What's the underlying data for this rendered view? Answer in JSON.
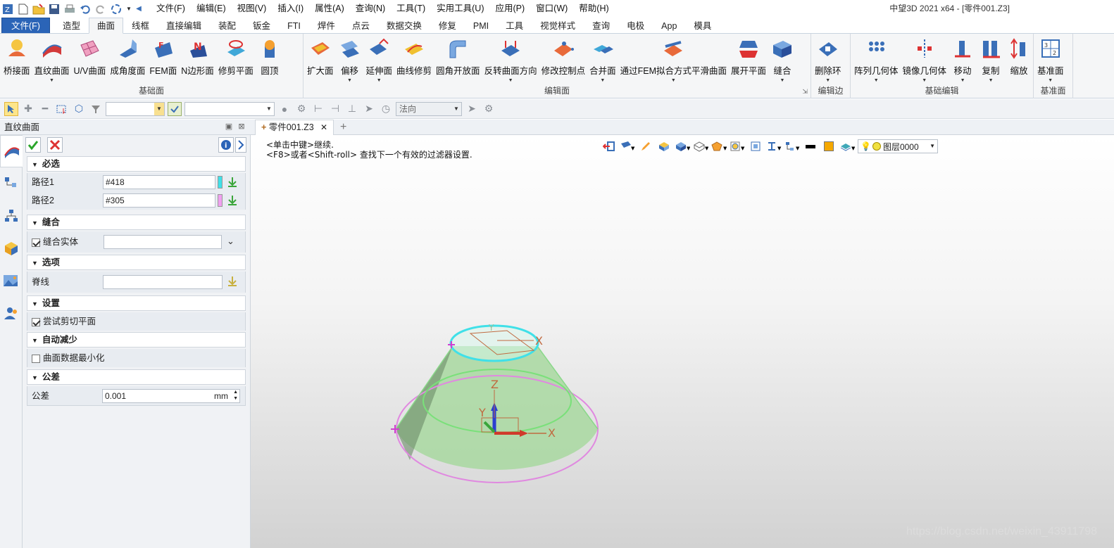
{
  "menubar": [
    "文件(F)",
    "编辑(E)",
    "视图(V)",
    "插入(I)",
    "属性(A)",
    "查询(N)",
    "工具(T)",
    "实用工具(U)",
    "应用(P)",
    "窗口(W)",
    "帮助(H)"
  ],
  "app_title": "中望3D 2021 x64 - [零件001.Z3]",
  "ribbon_tabs": [
    "文件(F)",
    "造型",
    "曲面",
    "线框",
    "直接编辑",
    "装配",
    "钣金",
    "FTI",
    "焊件",
    "点云",
    "数据交换",
    "修复",
    "PMI",
    "工具",
    "视觉样式",
    "查询",
    "电极",
    "App",
    "模具"
  ],
  "ribbon_groups": {
    "basic_surface": {
      "label": "基础面",
      "items": [
        "桥接面",
        "直纹曲面",
        "U/V曲面",
        "成角度面",
        "FEM面",
        "N边形面",
        "修剪平面",
        "圆顶"
      ]
    },
    "edit_surface": {
      "label": "编辑面",
      "items": [
        "扩大面",
        "偏移",
        "延伸面",
        "曲线修剪",
        "圆角开放面",
        "反转曲面方向",
        "修改控制点",
        "合并面",
        "通过FEM拟合方式平滑曲面",
        "展开平面",
        "缝合"
      ]
    },
    "edit_edge": {
      "label": "编辑边",
      "items": [
        "删除环"
      ]
    },
    "basic_edit": {
      "label": "基础编辑",
      "items": [
        "阵列几何体",
        "镜像几何体",
        "移动",
        "复制",
        "缩放"
      ]
    },
    "datum": {
      "label": "基准面",
      "items": [
        "基准面"
      ]
    }
  },
  "toolbar": {
    "direction_placeholder": "法向"
  },
  "panel": {
    "title": "直纹曲面",
    "sections": {
      "required": "必选",
      "stitch": "缝合",
      "options": "选项",
      "settings": "设置",
      "auto_reduce": "自动减少",
      "tolerance": "公差"
    },
    "path1_label": "路径1",
    "path1_value": "#418",
    "path2_label": "路径2",
    "path2_value": "#305",
    "stitch_solid_label": "缝合实体",
    "spine_label": "脊线",
    "try_trim_plane_label": "尝试剪切平面",
    "minimize_surface_data_label": "曲面数据最小化",
    "tolerance_label": "公差",
    "tolerance_value": "0.001",
    "tolerance_unit": "mm",
    "stitch_solid_checked": true,
    "try_trim_plane_checked": true,
    "minimize_surface_data_checked": false
  },
  "document_tab": "零件001.Z3",
  "viewport": {
    "message_line1": "<单击中键>继续.",
    "message_line2": "<F8>或者<Shift-roll> 查找下一个有效的过滤器设置.",
    "layer": "图层0000",
    "axis_x": "X",
    "axis_y": "Y",
    "axis_z": "Z",
    "watermark": "https://blog.csdn.net/weixin_43911798"
  },
  "colors": {
    "path1_swatch": "#40e0e8",
    "path2_swatch": "#f0a0f0",
    "cone_fill": "#a8d8a0",
    "accent": "#2b64b7"
  }
}
